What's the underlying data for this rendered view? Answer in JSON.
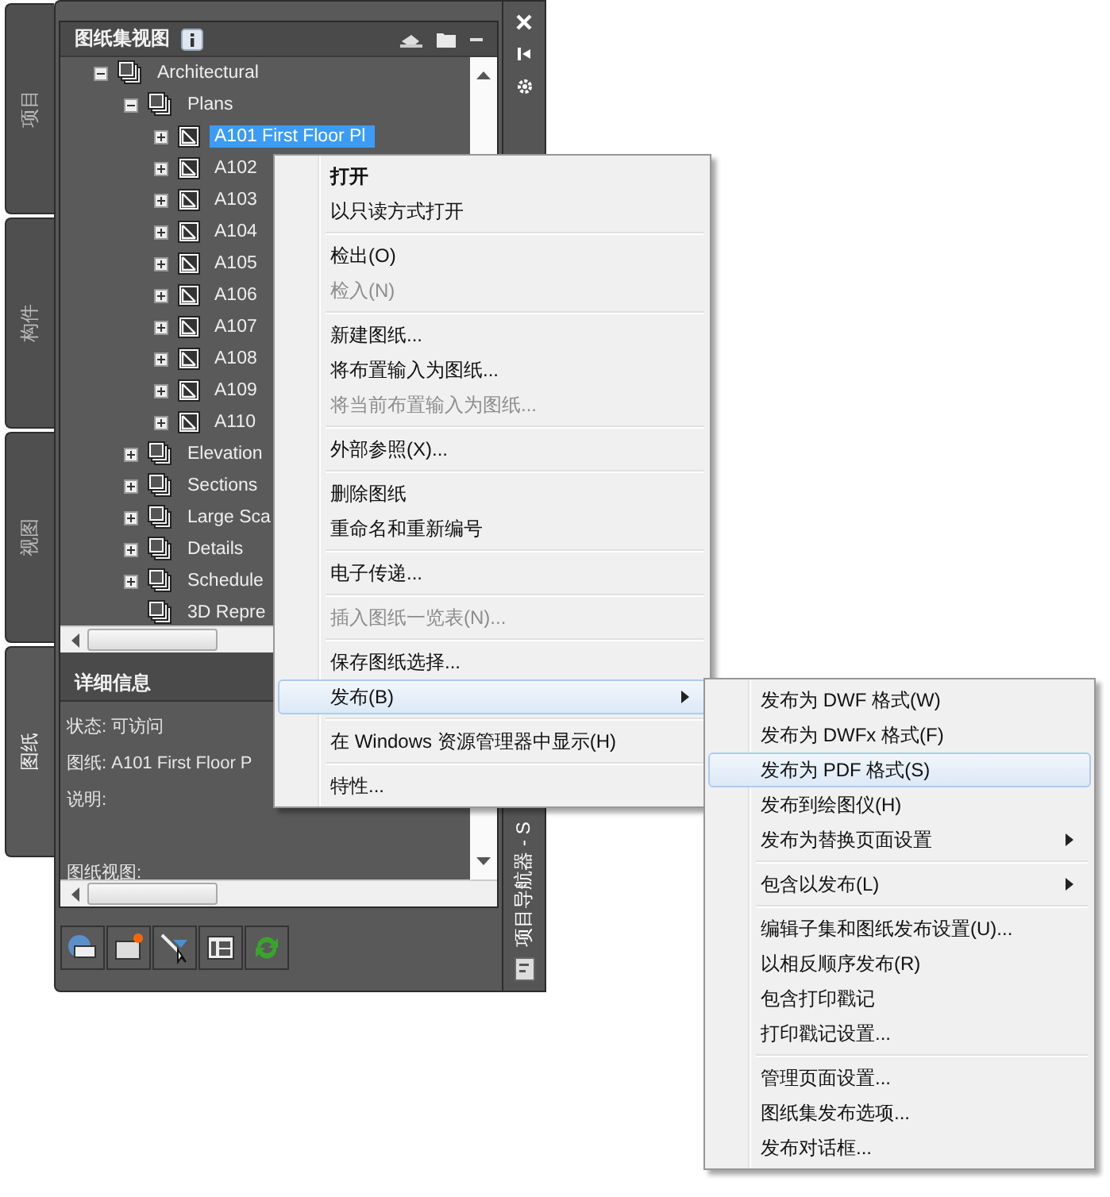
{
  "side_tabs": [
    {
      "label": "项目",
      "selected": false
    },
    {
      "label": "构件",
      "selected": false
    },
    {
      "label": "视图",
      "selected": false
    },
    {
      "label": "图纸",
      "selected": true
    }
  ],
  "palette": {
    "title": "图纸集视图",
    "side_label": "项目导航器 - S"
  },
  "tree": [
    {
      "label": "Architectural",
      "kind": "subset",
      "expandable": true,
      "expanded": true,
      "selected": false,
      "children": [
        {
          "label": "Plans",
          "kind": "subset",
          "expandable": true,
          "expanded": true,
          "selected": false,
          "children": [
            {
              "label": "A101 First Floor Pl",
              "kind": "sheet",
              "expandable": true,
              "expanded": false,
              "selected": true
            },
            {
              "label": "A102",
              "kind": "sheet",
              "expandable": true,
              "expanded": false,
              "selected": false
            },
            {
              "label": "A103",
              "kind": "sheet",
              "expandable": true,
              "expanded": false,
              "selected": false
            },
            {
              "label": "A104",
              "kind": "sheet",
              "expandable": true,
              "expanded": false,
              "selected": false
            },
            {
              "label": "A105",
              "kind": "sheet",
              "expandable": true,
              "expanded": false,
              "selected": false
            },
            {
              "label": "A106",
              "kind": "sheet",
              "expandable": true,
              "expanded": false,
              "selected": false
            },
            {
              "label": "A107",
              "kind": "sheet",
              "expandable": true,
              "expanded": false,
              "selected": false
            },
            {
              "label": "A108",
              "kind": "sheet",
              "expandable": true,
              "expanded": false,
              "selected": false
            },
            {
              "label": "A109",
              "kind": "sheet",
              "expandable": true,
              "expanded": false,
              "selected": false
            },
            {
              "label": "A110",
              "kind": "sheet",
              "expandable": true,
              "expanded": false,
              "selected": false
            }
          ]
        },
        {
          "label": "Elevation",
          "kind": "subset",
          "expandable": true,
          "expanded": false,
          "selected": false
        },
        {
          "label": "Sections",
          "kind": "subset",
          "expandable": true,
          "expanded": false,
          "selected": false
        },
        {
          "label": "Large Sca",
          "kind": "subset",
          "expandable": true,
          "expanded": false,
          "selected": false
        },
        {
          "label": "Details",
          "kind": "subset",
          "expandable": true,
          "expanded": false,
          "selected": false
        },
        {
          "label": "Schedule",
          "kind": "subset",
          "expandable": true,
          "expanded": false,
          "selected": false
        },
        {
          "label": "3D Repre",
          "kind": "subset",
          "selected": false
        }
      ]
    }
  ],
  "details": {
    "title": "详细信息",
    "lines": [
      "状态: 可访问",
      "图纸: A101 First Floor P",
      "说明:",
      "图纸视图:"
    ]
  },
  "context_menu": [
    {
      "kind": "item",
      "label": "打开",
      "default": true,
      "disabled": false,
      "selected": false,
      "submenu": false
    },
    {
      "kind": "item",
      "label": "以只读方式打开",
      "default": false,
      "disabled": false,
      "selected": false,
      "submenu": false
    },
    {
      "kind": "separator"
    },
    {
      "kind": "item",
      "label": "检出(O)",
      "default": false,
      "disabled": false,
      "selected": false,
      "submenu": false
    },
    {
      "kind": "item",
      "label": "检入(N)",
      "default": false,
      "disabled": true,
      "selected": false,
      "submenu": false
    },
    {
      "kind": "separator"
    },
    {
      "kind": "item",
      "label": "新建图纸...",
      "default": false,
      "disabled": false,
      "selected": false,
      "submenu": false
    },
    {
      "kind": "item",
      "label": "将布置输入为图纸...",
      "default": false,
      "disabled": false,
      "selected": false,
      "submenu": false
    },
    {
      "kind": "item",
      "label": "将当前布置输入为图纸...",
      "default": false,
      "disabled": true,
      "selected": false,
      "submenu": false
    },
    {
      "kind": "separator"
    },
    {
      "kind": "item",
      "label": "外部参照(X)...",
      "default": false,
      "disabled": false,
      "selected": false,
      "submenu": false
    },
    {
      "kind": "separator"
    },
    {
      "kind": "item",
      "label": "删除图纸",
      "default": false,
      "disabled": false,
      "selected": false,
      "submenu": false
    },
    {
      "kind": "item",
      "label": "重命名和重新编号",
      "default": false,
      "disabled": false,
      "selected": false,
      "submenu": false
    },
    {
      "kind": "separator"
    },
    {
      "kind": "item",
      "label": "电子传递...",
      "default": false,
      "disabled": false,
      "selected": false,
      "submenu": false
    },
    {
      "kind": "separator"
    },
    {
      "kind": "item",
      "label": "插入图纸一览表(N)...",
      "default": false,
      "disabled": true,
      "selected": false,
      "submenu": false
    },
    {
      "kind": "separator"
    },
    {
      "kind": "item",
      "label": "保存图纸选择...",
      "default": false,
      "disabled": false,
      "selected": false,
      "submenu": false
    },
    {
      "kind": "item",
      "label": "发布(B)",
      "default": false,
      "disabled": false,
      "selected": true,
      "submenu": true
    },
    {
      "kind": "separator"
    },
    {
      "kind": "item",
      "label": "在 Windows 资源管理器中显示(H)",
      "default": false,
      "disabled": false,
      "selected": false,
      "submenu": false
    },
    {
      "kind": "separator"
    },
    {
      "kind": "item",
      "label": "特性...",
      "default": false,
      "disabled": false,
      "selected": false,
      "submenu": false
    }
  ],
  "publish_menu": [
    {
      "kind": "item",
      "label": "发布为 DWF 格式(W)",
      "selected": false,
      "submenu": false
    },
    {
      "kind": "item",
      "label": "发布为 DWFx 格式(F)",
      "selected": false,
      "submenu": false
    },
    {
      "kind": "item",
      "label": "发布为 PDF 格式(S)",
      "selected": true,
      "submenu": false
    },
    {
      "kind": "item",
      "label": "发布到绘图仪(H)",
      "selected": false,
      "submenu": false
    },
    {
      "kind": "item",
      "label": "发布为替换页面设置",
      "selected": false,
      "submenu": true
    },
    {
      "kind": "separator"
    },
    {
      "kind": "item",
      "label": "包含以发布(L)",
      "selected": false,
      "submenu": true
    },
    {
      "kind": "separator"
    },
    {
      "kind": "item",
      "label": "编辑子集和图纸发布设置(U)...",
      "selected": false,
      "submenu": false
    },
    {
      "kind": "item",
      "label": "以相反顺序发布(R)",
      "selected": false,
      "submenu": false
    },
    {
      "kind": "item",
      "label": "包含打印戳记",
      "selected": false,
      "submenu": false
    },
    {
      "kind": "item",
      "label": "打印戳记设置...",
      "selected": false,
      "submenu": false
    },
    {
      "kind": "separator"
    },
    {
      "kind": "item",
      "label": "管理页面设置...",
      "selected": false,
      "submenu": false
    },
    {
      "kind": "item",
      "label": "图纸集发布选项...",
      "selected": false,
      "submenu": false
    },
    {
      "kind": "item",
      "label": "发布对话框...",
      "selected": false,
      "submenu": false
    }
  ]
}
